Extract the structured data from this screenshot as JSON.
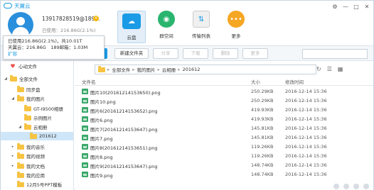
{
  "app": {
    "title": "天翼云"
  },
  "window_controls": [
    "⚙",
    "—",
    "□",
    "✕"
  ],
  "user": {
    "name": "13917828519@189...",
    "vip_badge": "V",
    "used_label": "已使用：216.86G(2.1%)"
  },
  "nav": [
    {
      "label": "云盘",
      "icon": "cloud-disk-icon"
    },
    {
      "label": "群空间",
      "icon": "group-space-icon"
    },
    {
      "label": "传输列表",
      "icon": "transfer-list-icon"
    },
    {
      "label": "更多",
      "icon": "more-icon"
    }
  ],
  "popover": {
    "line1": "已使用216.86G(2.1%)，共10.01T",
    "line2": "天翼云：216.86G　189邮箱：1.03M",
    "expand": "扩容"
  },
  "toolbar": {
    "new_folder": "新建文件夹",
    "share": "分享",
    "download": "下载",
    "delete": "删除",
    "more": "更多"
  },
  "sidebar": {
    "favorites": "心动文件",
    "items": [
      {
        "label": "全部文件",
        "arrow": "◢"
      },
      {
        "label": "同步盘",
        "arrow": ""
      },
      {
        "label": "我的图片",
        "arrow": "◢"
      },
      {
        "label": "GT-I9500相册",
        "arrow": ""
      },
      {
        "label": "示例图片",
        "arrow": ""
      },
      {
        "label": "云相册",
        "arrow": "◢"
      },
      {
        "label": "201612",
        "arrow": ""
      },
      {
        "label": "我的音乐",
        "arrow": "▸"
      },
      {
        "label": "我的视频",
        "arrow": "▸"
      },
      {
        "label": "我的文档",
        "arrow": "▸"
      },
      {
        "label": "我的应用",
        "arrow": ""
      },
      {
        "label": "12月5号PPT模板",
        "arrow": ""
      }
    ]
  },
  "breadcrumb": [
    "全部文件",
    "我的图片",
    "云相册",
    "201612"
  ],
  "columns": {
    "name": "文件名",
    "size": "大小",
    "time": "修改时间"
  },
  "files": [
    {
      "name": "图片10(20161214153650).png",
      "size": "250.29KB",
      "time": "2016-12-14 15:36"
    },
    {
      "name": "图片10.png",
      "size": "250.29KB",
      "time": "2016-12-14 15:36"
    },
    {
      "name": "图片6(20161214153652).png",
      "size": "419.93KB",
      "time": "2016-12-14 15:36"
    },
    {
      "name": "图片6.png",
      "size": "419.93KB",
      "time": "2016-12-14 15:36"
    },
    {
      "name": "图片7(20161214153647).png",
      "size": "145.81KB",
      "time": "2016-12-14 15:36"
    },
    {
      "name": "图片7.png",
      "size": "145.81KB",
      "time": "2016-12-14 15:36"
    },
    {
      "name": "图片8(20161214153651).png",
      "size": "119.26KB",
      "time": "2016-12-14 15:36"
    },
    {
      "name": "图片8.png",
      "size": "119.26KB",
      "time": "2016-12-14 15:36"
    },
    {
      "name": "图片9(20161214153647).png",
      "size": "148.74KB",
      "time": "2016-12-14 15:36"
    },
    {
      "name": "图片9.png",
      "size": "148.74KB",
      "time": "2016-12-14 15:36"
    }
  ]
}
